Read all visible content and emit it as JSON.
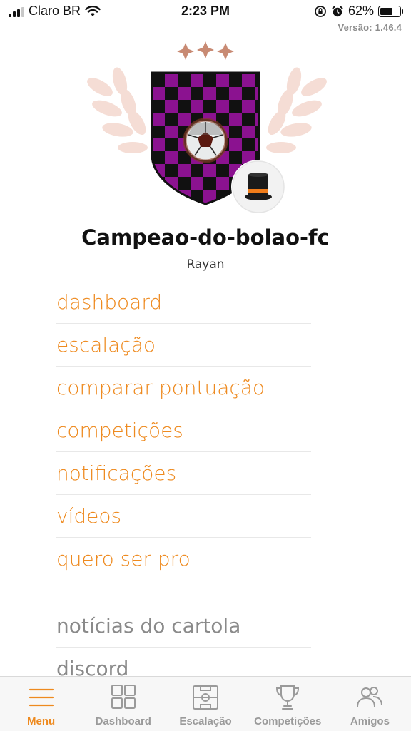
{
  "status_bar": {
    "carrier": "Claro BR",
    "time": "2:23 PM",
    "battery": "62%"
  },
  "version": "Versão: 1.46.4",
  "profile": {
    "team_name": "Campeao-do-bolao-fc",
    "owner": "Rayan",
    "stars": 3
  },
  "menu": {
    "primary_items": [
      {
        "label": "dashboard"
      },
      {
        "label": "escalação"
      },
      {
        "label": "comparar pontuação"
      },
      {
        "label": "competições"
      },
      {
        "label": "notificações"
      },
      {
        "label": "vídeos"
      },
      {
        "label": "quero ser pro"
      }
    ],
    "secondary_items": [
      {
        "label": "notícias do cartola"
      },
      {
        "label": "discord"
      }
    ]
  },
  "tabbar": {
    "tabs": [
      {
        "label": "Menu",
        "icon": "menu-icon",
        "active": true
      },
      {
        "label": "Dashboard",
        "icon": "dashboard-icon",
        "active": false
      },
      {
        "label": "Escalação",
        "icon": "field-icon",
        "active": false
      },
      {
        "label": "Competições",
        "icon": "trophy-icon",
        "active": false
      },
      {
        "label": "Amigos",
        "icon": "friends-icon",
        "active": false
      }
    ]
  },
  "colors": {
    "accent": "#ee8a1f",
    "muted": "#8a8a8a",
    "shield_purple": "#8b1290",
    "shield_black": "#111111",
    "laurel": "#f5ddd5",
    "stars": "#c88a73"
  }
}
